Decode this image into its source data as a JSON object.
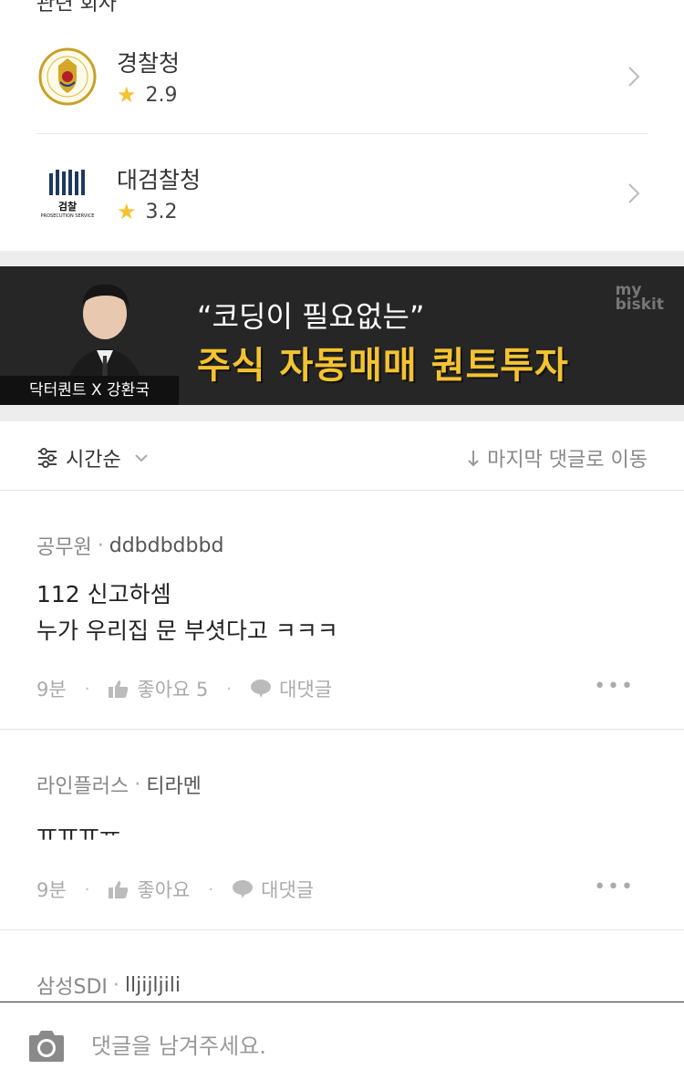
{
  "top": {
    "section_title": "관련 회사",
    "companies": [
      {
        "name": "경찰청",
        "rating": "2.9"
      },
      {
        "name": "대검찰청",
        "rating": "3.2"
      }
    ],
    "prosecution_logo_text": "검찰",
    "prosecution_logo_sub": "PROSECUTION SERVICE"
  },
  "banner": {
    "quote": "“코딩이 필요없는”",
    "headline": "주식 자동매매 퀀트투자",
    "tag": "닥터퀀트 X 강환국",
    "brand_line1": "my",
    "brand_line2": "biskit"
  },
  "sort": {
    "label": "시간순",
    "jump_label": "마지막 댓글로 이동"
  },
  "comments": [
    {
      "company": "공무원",
      "nickname": "ddbdbdbbd",
      "lines": [
        "112 신고하셈",
        "누가 우리집 문 부셧다고 ㅋㅋㅋ"
      ],
      "time": "9분",
      "like_label": "좋아요 5",
      "reply_label": "대댓글",
      "more": "•••"
    },
    {
      "company": "라인플러스",
      "nickname": "티라멘",
      "lines": [
        "ㅠㅠㅠᅲ"
      ],
      "time": "9분",
      "like_label": "좋아요",
      "reply_label": "대댓글",
      "more": "•••"
    },
    {
      "company": "삼성SDI",
      "nickname": "lljijljili"
    }
  ],
  "input": {
    "placeholder": "댓글을 남겨주세요."
  },
  "icons": {
    "star": "star-icon",
    "chevron": "chevron-right-icon",
    "sort": "sliders-icon",
    "arrow": "arrow-down-icon",
    "like": "thumbs-up-icon",
    "reply": "speech-bubble-icon",
    "camera": "camera-icon"
  },
  "colors": {
    "star": "#f4c330",
    "banner_bg": "#262626",
    "banner_headline": "#f4c330"
  }
}
